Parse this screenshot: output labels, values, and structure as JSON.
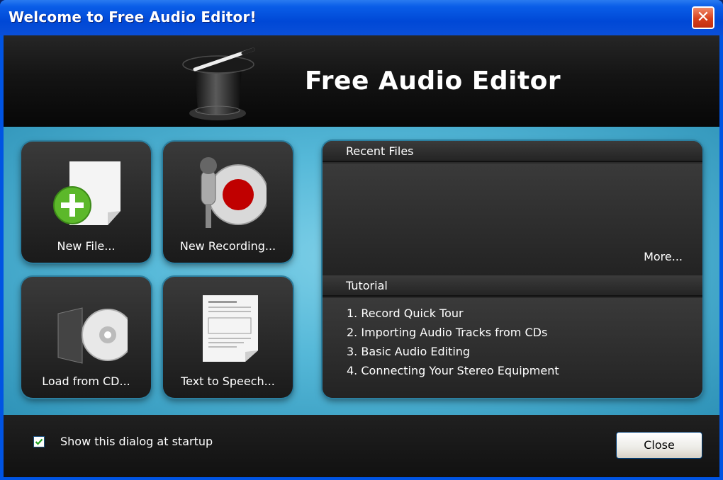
{
  "window": {
    "title": "Welcome to Free Audio Editor!"
  },
  "banner": {
    "app_name": "Free Audio Editor"
  },
  "tiles": [
    {
      "label": "New File..."
    },
    {
      "label": "New Recording..."
    },
    {
      "label": "Load from CD..."
    },
    {
      "label": "Text to Speech..."
    }
  ],
  "recent_files": {
    "header": "Recent Files",
    "more_label": "More..."
  },
  "tutorial": {
    "header": "Tutorial",
    "items": [
      "1. Record Quick Tour",
      "2. Importing Audio Tracks from CDs",
      "3. Basic Audio Editing",
      "4. Connecting Your Stereo Equipment"
    ]
  },
  "footer": {
    "startup_label": "Show this dialog at startup",
    "startup_checked": true,
    "close_label": "Close"
  },
  "colors": {
    "titlebar": "#0054e3",
    "accent_cyan": "#55b8d8",
    "record_red": "#c00000",
    "add_green": "#5cb82a"
  }
}
